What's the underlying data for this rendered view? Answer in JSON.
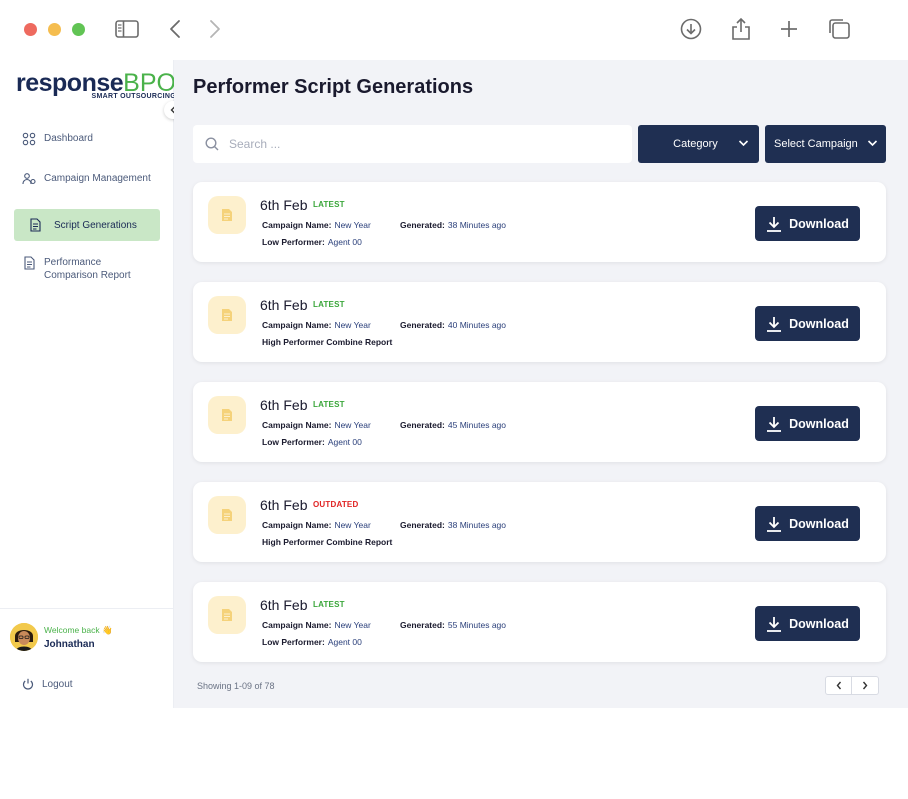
{
  "browser": {
    "icons": [
      "sidebar-toggle-icon",
      "back-icon",
      "forward-icon",
      "download-icon",
      "share-icon",
      "new-tab-icon",
      "tabs-icon"
    ]
  },
  "brand": {
    "name_main": "response",
    "name_accent": "BPO",
    "tagline": "SMART OUTSOURCING",
    "accent_color": "#4ab24a",
    "primary_color": "#1f2f52"
  },
  "sidebar": {
    "items": [
      {
        "label": "Dashboard",
        "icon": "dashboard-icon",
        "active": false
      },
      {
        "label": "Campaign Management",
        "icon": "campaign-icon",
        "active": false
      },
      {
        "label": "Script Generations",
        "icon": "document-icon",
        "active": true
      },
      {
        "label": "Performance Comparison Report",
        "icon": "report-icon",
        "active": false
      }
    ],
    "user": {
      "welcome": "Welcome back 👋",
      "name": "Johnathan"
    },
    "logout_label": "Logout"
  },
  "main": {
    "title": "Performer Script Generations",
    "search_placeholder": "Search ...",
    "category_label": "Category",
    "campaign_label": "Select Campaign",
    "cards": [
      {
        "date": "6th Feb",
        "status": "LATEST",
        "campaign_key": "Campaign Name:",
        "campaign": "New Year",
        "generated_key": "Generated:",
        "generated": "38 Minutes ago",
        "line3_key": "Low Performer:",
        "line3_value": "Agent 00",
        "button": "Download"
      },
      {
        "date": "6th Feb",
        "status": "LATEST",
        "campaign_key": "Campaign Name:",
        "campaign": "New Year",
        "generated_key": "Generated:",
        "generated": "40 Minutes ago",
        "line3_key": "High Performer Combine Report",
        "line3_value": "",
        "button": "Download"
      },
      {
        "date": "6th Feb",
        "status": "LATEST",
        "campaign_key": "Campaign Name:",
        "campaign": "New Year",
        "generated_key": "Generated:",
        "generated": "45 Minutes ago",
        "line3_key": "Low Performer:",
        "line3_value": "Agent 00",
        "button": "Download"
      },
      {
        "date": "6th Feb",
        "status": "OUTDATED",
        "campaign_key": "Campaign Name:",
        "campaign": "New Year",
        "generated_key": "Generated:",
        "generated": "38 Minutes ago",
        "line3_key": "High Performer Combine Report",
        "line3_value": "",
        "button": "Download"
      },
      {
        "date": "6th Feb",
        "status": "LATEST",
        "campaign_key": "Campaign Name:",
        "campaign": "New Year",
        "generated_key": "Generated:",
        "generated": "55 Minutes ago",
        "line3_key": "Low Performer:",
        "line3_value": "Agent 00",
        "button": "Download"
      }
    ],
    "showing": "Showing 1-09 of 78"
  }
}
